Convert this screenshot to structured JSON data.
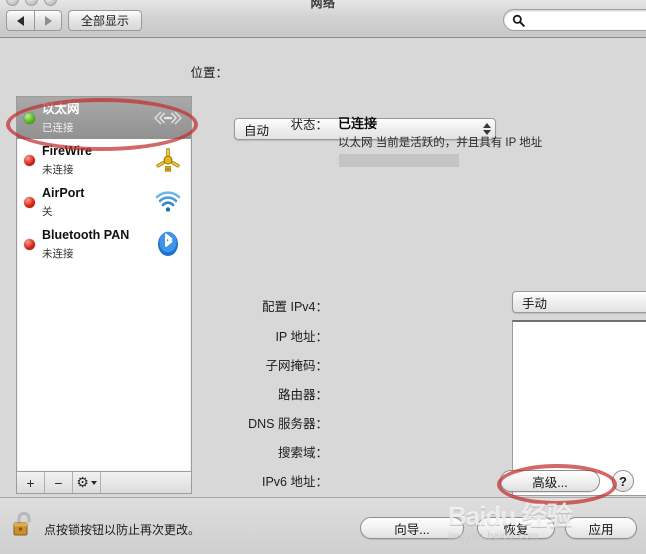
{
  "window": {
    "title": "网络",
    "traffic_lights": [
      "close",
      "minimize",
      "zoom"
    ]
  },
  "toolbar": {
    "back_label": "◀",
    "forward_label": "▶",
    "show_all_label": "全部显示",
    "search_value": "",
    "search_placeholder": ""
  },
  "location": {
    "label": "位置：",
    "selected": "自动"
  },
  "sidebar": {
    "items": [
      {
        "name": "以太网",
        "status": "已连接",
        "dot": "green",
        "icon": "ethernet-icon",
        "selected": true
      },
      {
        "name": "FireWire",
        "status": "未连接",
        "dot": "red",
        "icon": "firewire-icon",
        "selected": false
      },
      {
        "name": "AirPort",
        "status": "关",
        "dot": "red",
        "icon": "airport-icon",
        "selected": false
      },
      {
        "name": "Bluetooth PAN",
        "status": "未连接",
        "dot": "red",
        "icon": "bluetooth-icon",
        "selected": false
      }
    ],
    "toolbar": {
      "add_label": "+",
      "remove_label": "−",
      "action_label": "⚙"
    }
  },
  "details": {
    "status_label": "状态：",
    "status_value": "已连接",
    "status_desc": "以太网 当前是活跃的，并且具有 IP 地址",
    "status_ip_redacted": "",
    "configure_ipv4_label": "配置 IPv4：",
    "configure_ipv4_value": "手动",
    "fields": [
      {
        "label": "IP 地址：",
        "value": ""
      },
      {
        "label": "子网掩码：",
        "value": ""
      },
      {
        "label": "路由器：",
        "value": ""
      },
      {
        "label": "DNS 服务器：",
        "value": ""
      },
      {
        "label": "搜索域：",
        "value": ""
      },
      {
        "label": "IPv6 地址：",
        "value": ""
      }
    ]
  },
  "actions": {
    "advanced_label": "高级...",
    "help_label": "?",
    "wizard_label": "向导...",
    "revert_label": "恢复",
    "apply_label": "应用"
  },
  "footer": {
    "lock_text": "点按锁按钮以防止再次更改。"
  },
  "watermark": {
    "main": "Baidu 经验",
    "sub": "jingyan.baidu.com"
  },
  "colors": {
    "connected_dot": "#4fb81d",
    "disconnected_dot": "#d42311",
    "annotation": "#c12e2e",
    "selection": "#919191"
  }
}
